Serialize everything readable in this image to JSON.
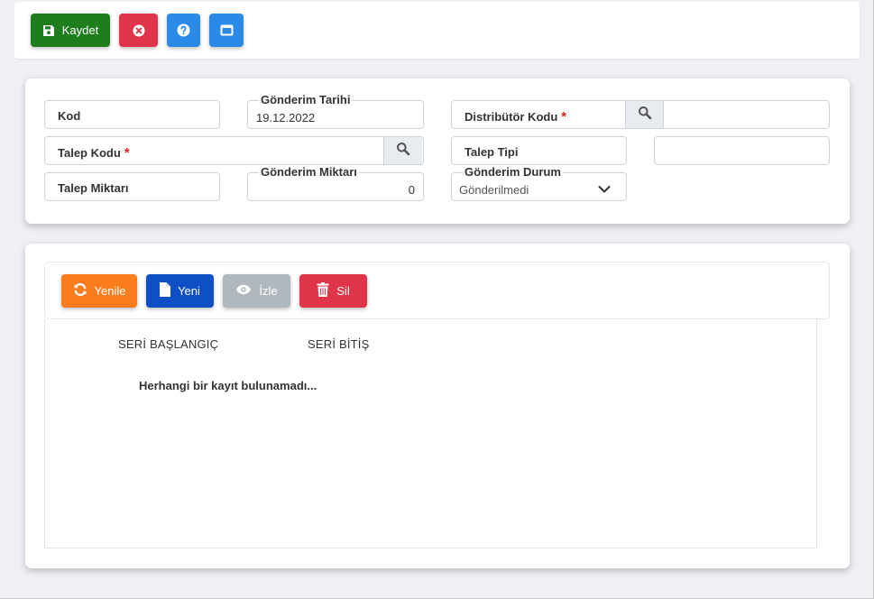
{
  "toolbar": {
    "save_label": "Kaydet"
  },
  "form": {
    "kod": {
      "label": "Kod"
    },
    "gonderim_tarihi": {
      "label": "Gönderim Tarihi",
      "value": "19.12.2022"
    },
    "distributor_kodu": {
      "label": "Distribütör Kodu",
      "required_mark": "*"
    },
    "talep_kodu": {
      "label": "Talep Kodu",
      "required_mark": "*"
    },
    "talep_tipi": {
      "label": "Talep Tipi"
    },
    "talep_miktari": {
      "label": "Talep Miktarı"
    },
    "gonderim_miktari": {
      "label": "Gönderim Miktarı",
      "value": "0"
    },
    "gonderim_durum": {
      "label": "Gönderim Durum",
      "value": "Gönderilmedi"
    }
  },
  "grid": {
    "buttons": {
      "refresh_label": "Yenile",
      "new_label": "Yeni",
      "view_label": "İzle",
      "delete_label": "Sil"
    },
    "columns": [
      "SERİ BAŞLANGIÇ",
      "SERİ BİTİŞ"
    ],
    "rows": [],
    "empty_message": "Herhangi bir kayıt bulunamadı..."
  },
  "colors": {
    "save": "#1e7e1e",
    "cancel": "#e0344a",
    "help": "#2b8ae8",
    "refresh": "#fb7c1c",
    "new": "#0e4fc4",
    "view_disabled": "#b0b7bf",
    "delete": "#e0344a",
    "required": "#e02020"
  },
  "icons": {
    "save": "floppy-disk-icon",
    "cancel": "close-circle-icon",
    "help": "question-circle-icon",
    "window": "window-icon",
    "search": "search-icon",
    "dropdown": "chevron-down-icon",
    "refresh": "refresh-icon",
    "new": "file-icon",
    "view": "eye-icon",
    "delete": "trash-icon"
  }
}
